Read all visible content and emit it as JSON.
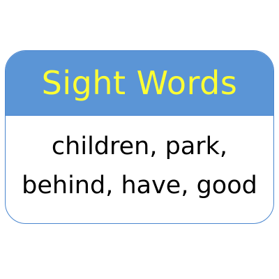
{
  "card": {
    "title": "Sight Words",
    "lines": [
      "children, park,",
      "behind, have, good"
    ]
  },
  "colors": {
    "header_background": "#5b95d6",
    "title_text": "#ffff33",
    "border": "#4a86cf",
    "body_text": "#000000"
  }
}
